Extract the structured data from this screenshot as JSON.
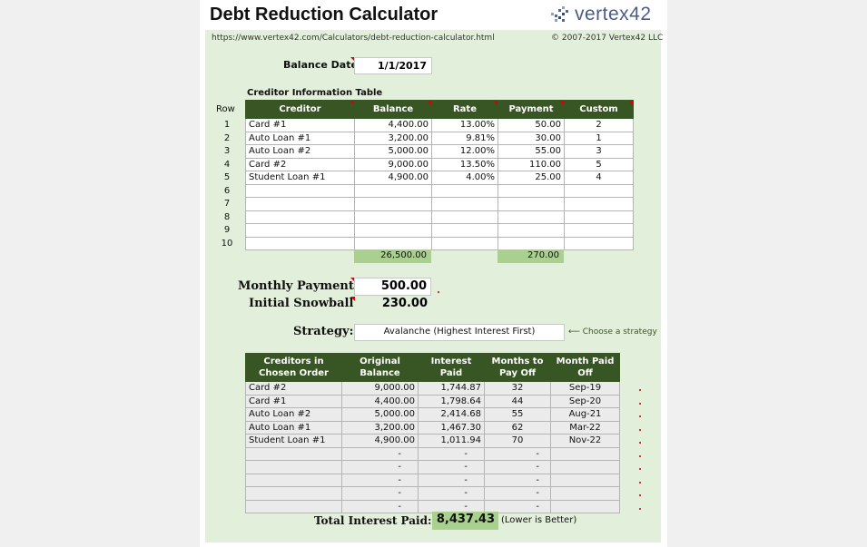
{
  "header": {
    "title": "Debt Reduction Calculator",
    "logo_text": "vertex42",
    "url": "https://www.vertex42.com/Calculators/debt-reduction-calculator.html",
    "copyright": "© 2007-2017 Vertex42 LLC"
  },
  "balance_date": {
    "label": "Balance Date:",
    "value": "1/1/2017"
  },
  "creditor_table": {
    "title": "Creditor Information Table",
    "row_label": "Row",
    "columns": [
      "Creditor",
      "Balance",
      "Rate",
      "Payment",
      "Custom"
    ],
    "rows": [
      {
        "num": "1",
        "creditor": "Card #1",
        "balance": "4,400.00",
        "rate": "13.00%",
        "payment": "50.00",
        "custom": "2"
      },
      {
        "num": "2",
        "creditor": "Auto Loan #1",
        "balance": "3,200.00",
        "rate": "9.81%",
        "payment": "30.00",
        "custom": "1"
      },
      {
        "num": "3",
        "creditor": "Auto Loan #2",
        "balance": "5,000.00",
        "rate": "12.00%",
        "payment": "55.00",
        "custom": "3"
      },
      {
        "num": "4",
        "creditor": "Card #2",
        "balance": "9,000.00",
        "rate": "13.50%",
        "payment": "110.00",
        "custom": "5"
      },
      {
        "num": "5",
        "creditor": "Student Loan #1",
        "balance": "4,900.00",
        "rate": "4.00%",
        "payment": "25.00",
        "custom": "4"
      },
      {
        "num": "6",
        "creditor": "",
        "balance": "",
        "rate": "",
        "payment": "",
        "custom": ""
      },
      {
        "num": "7",
        "creditor": "",
        "balance": "",
        "rate": "",
        "payment": "",
        "custom": ""
      },
      {
        "num": "8",
        "creditor": "",
        "balance": "",
        "rate": "",
        "payment": "",
        "custom": ""
      },
      {
        "num": "9",
        "creditor": "",
        "balance": "",
        "rate": "",
        "payment": "",
        "custom": ""
      },
      {
        "num": "10",
        "creditor": "",
        "balance": "",
        "rate": "",
        "payment": "",
        "custom": ""
      }
    ],
    "total_balance": "26,500.00",
    "total_payment": "270.00"
  },
  "monthly_payment": {
    "label": "Monthly Payment",
    "value": "500.00"
  },
  "initial_snowball": {
    "label": "Initial Snowball",
    "value": "230.00"
  },
  "strategy": {
    "label": "Strategy:",
    "value": "Avalanche (Highest Interest First)",
    "hint": "⟵ Choose a strategy"
  },
  "plan_table": {
    "columns": [
      "Creditors in Chosen Order",
      "Original Balance",
      "Interest Paid",
      "Months to Pay Off",
      "Month Paid Off"
    ],
    "rows": [
      {
        "creditor": "Card #2",
        "balance": "9,000.00",
        "interest": "1,744.87",
        "months": "32",
        "paid_off": "Sep-19"
      },
      {
        "creditor": "Card #1",
        "balance": "4,400.00",
        "interest": "1,798.64",
        "months": "44",
        "paid_off": "Sep-20"
      },
      {
        "creditor": "Auto Loan #2",
        "balance": "5,000.00",
        "interest": "2,414.68",
        "months": "55",
        "paid_off": "Aug-21"
      },
      {
        "creditor": "Auto Loan #1",
        "balance": "3,200.00",
        "interest": "1,467.30",
        "months": "62",
        "paid_off": "Mar-22"
      },
      {
        "creditor": "Student Loan #1",
        "balance": "4,900.00",
        "interest": "1,011.94",
        "months": "70",
        "paid_off": "Nov-22"
      },
      {
        "creditor": "",
        "balance": "-",
        "interest": "-",
        "months": "-",
        "paid_off": ""
      },
      {
        "creditor": "",
        "balance": "-",
        "interest": "-",
        "months": "-",
        "paid_off": ""
      },
      {
        "creditor": "",
        "balance": "-",
        "interest": "-",
        "months": "-",
        "paid_off": ""
      },
      {
        "creditor": "",
        "balance": "-",
        "interest": "-",
        "months": "-",
        "paid_off": ""
      },
      {
        "creditor": "",
        "balance": "-",
        "interest": "-",
        "months": "-",
        "paid_off": ""
      }
    ]
  },
  "total_interest": {
    "label": "Total Interest Paid:",
    "value": "8,437.43",
    "note": "(Lower is Better)"
  },
  "colors": {
    "header_green": "#375623",
    "panel_green": "#e2efda",
    "total_green": "#a9d08e",
    "comment_red": "#e00000"
  }
}
